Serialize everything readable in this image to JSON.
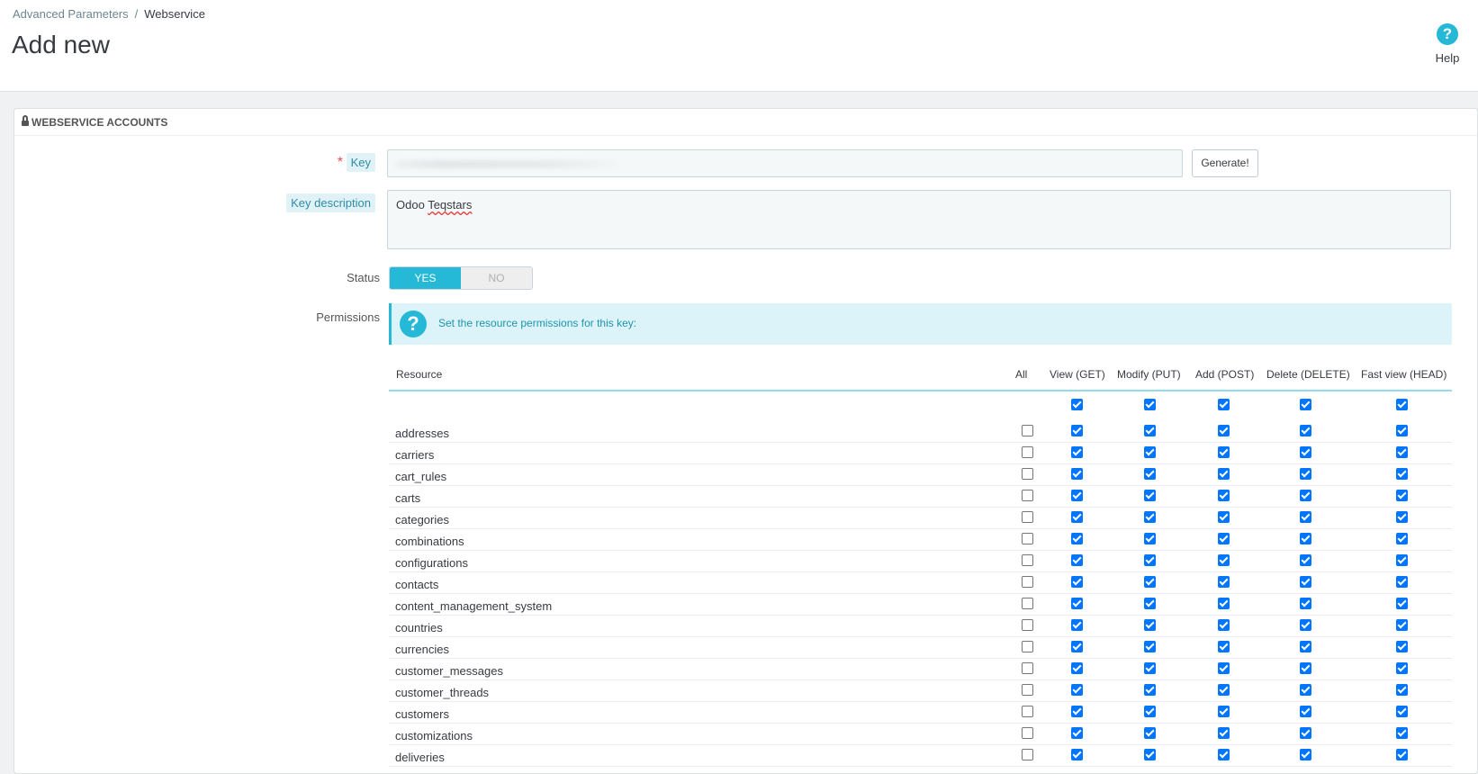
{
  "breadcrumb": {
    "parent": "Advanced Parameters",
    "separator": "/",
    "current": "Webservice"
  },
  "page_title": "Add new",
  "help": {
    "label": "Help",
    "icon": "question-circle-icon"
  },
  "panel": {
    "heading": "Webservice accounts",
    "icon": "lock-icon"
  },
  "form": {
    "key_required_mark": "*",
    "key_label": "Key",
    "generate_label": "Generate!",
    "description_label": "Key description",
    "description_first": "Odoo",
    "description_second": "Teqstars",
    "status_label": "Status",
    "status_yes": "YES",
    "status_no": "NO",
    "status_value": "YES",
    "permissions_label": "Permissions",
    "permissions_info": "Set the resource permissions for this key:"
  },
  "table": {
    "headers": {
      "resource": "Resource",
      "all": "All",
      "get": "View (GET)",
      "put": "Modify (PUT)",
      "post": "Add (POST)",
      "delete": "Delete (DELETE)",
      "head": "Fast view (HEAD)"
    },
    "select_all_row": {
      "get": true,
      "put": true,
      "post": true,
      "delete": true,
      "head": true
    },
    "rows": [
      {
        "name": "addresses",
        "all": false,
        "get": true,
        "put": true,
        "post": true,
        "delete": true,
        "head": true
      },
      {
        "name": "carriers",
        "all": false,
        "get": true,
        "put": true,
        "post": true,
        "delete": true,
        "head": true
      },
      {
        "name": "cart_rules",
        "all": false,
        "get": true,
        "put": true,
        "post": true,
        "delete": true,
        "head": true
      },
      {
        "name": "carts",
        "all": false,
        "get": true,
        "put": true,
        "post": true,
        "delete": true,
        "head": true
      },
      {
        "name": "categories",
        "all": false,
        "get": true,
        "put": true,
        "post": true,
        "delete": true,
        "head": true
      },
      {
        "name": "combinations",
        "all": false,
        "get": true,
        "put": true,
        "post": true,
        "delete": true,
        "head": true
      },
      {
        "name": "configurations",
        "all": false,
        "get": true,
        "put": true,
        "post": true,
        "delete": true,
        "head": true
      },
      {
        "name": "contacts",
        "all": false,
        "get": true,
        "put": true,
        "post": true,
        "delete": true,
        "head": true
      },
      {
        "name": "content_management_system",
        "all": false,
        "get": true,
        "put": true,
        "post": true,
        "delete": true,
        "head": true
      },
      {
        "name": "countries",
        "all": false,
        "get": true,
        "put": true,
        "post": true,
        "delete": true,
        "head": true
      },
      {
        "name": "currencies",
        "all": false,
        "get": true,
        "put": true,
        "post": true,
        "delete": true,
        "head": true
      },
      {
        "name": "customer_messages",
        "all": false,
        "get": true,
        "put": true,
        "post": true,
        "delete": true,
        "head": true
      },
      {
        "name": "customer_threads",
        "all": false,
        "get": true,
        "put": true,
        "post": true,
        "delete": true,
        "head": true
      },
      {
        "name": "customers",
        "all": false,
        "get": true,
        "put": true,
        "post": true,
        "delete": true,
        "head": true
      },
      {
        "name": "customizations",
        "all": false,
        "get": true,
        "put": true,
        "post": true,
        "delete": true,
        "head": true
      },
      {
        "name": "deliveries",
        "all": false,
        "get": true,
        "put": true,
        "post": true,
        "delete": true,
        "head": true
      }
    ]
  },
  "colors": {
    "accent": "#25b9d7",
    "checkbox": "#0075ff",
    "required": "#e84e4e"
  }
}
